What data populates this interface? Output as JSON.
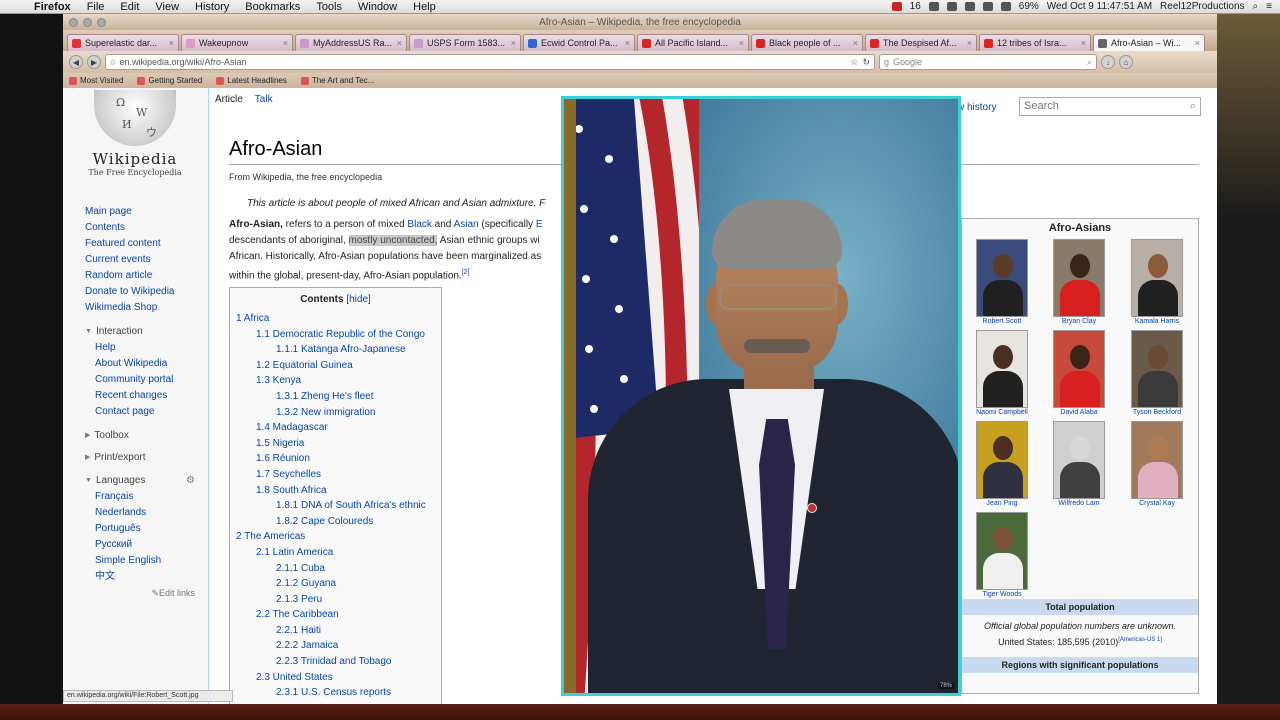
{
  "menubar": {
    "app": "Firefox",
    "items": [
      "File",
      "Edit",
      "View",
      "History",
      "Bookmarks",
      "Tools",
      "Window",
      "Help"
    ],
    "badge_count": "16",
    "battery": "69%",
    "clock": "Wed Oct 9  11:47:51 AM",
    "user": "Reel12Productions"
  },
  "window": {
    "title": "Afro-Asian – Wikipedia, the free encyclopedia"
  },
  "tabs": [
    {
      "label": "Superelastic dar...",
      "color": "#d33"
    },
    {
      "label": "Wakeupnow",
      "color": "#d9c"
    },
    {
      "label": "MyAddressUS Ra...",
      "color": "#c9c"
    },
    {
      "label": "USPS Form 1583...",
      "color": "#c9c"
    },
    {
      "label": "Ecwid Control Pa...",
      "color": "#36c"
    },
    {
      "label": "All Pacific Island...",
      "color": "#d22"
    },
    {
      "label": "Black people of ...",
      "color": "#d22"
    },
    {
      "label": "The Despised Af...",
      "color": "#d22"
    },
    {
      "label": "12 tribes of Isra...",
      "color": "#d22"
    },
    {
      "label": "Afro-Asian – Wi...",
      "color": "#666"
    }
  ],
  "navbar": {
    "url": "en.wikipedia.org/wiki/Afro-Asian",
    "search_placeholder": "Google"
  },
  "bookmarks": [
    "Most Visited",
    "Getting Started",
    "Latest Headlines",
    "The Art and Tec..."
  ],
  "wiki": {
    "logo_word": "Wikipedia",
    "logo_tag": "The Free Encyclopedia",
    "nav": [
      "Main page",
      "Contents",
      "Featured content",
      "Current events",
      "Random article",
      "Donate to Wikipedia",
      "Wikimedia Shop"
    ],
    "interaction_head": "Interaction",
    "interaction": [
      "Help",
      "About Wikipedia",
      "Community portal",
      "Recent changes",
      "Contact page"
    ],
    "toolbox": "Toolbox",
    "print": "Print/export",
    "languages_head": "Languages",
    "languages": [
      "Français",
      "Nederlands",
      "Português",
      "Русский",
      "Simple English",
      "中文"
    ],
    "edit_links": "Edit links",
    "tab_article": "Article",
    "tab_talk": "Talk",
    "view_history": "w history",
    "search_placeholder": "Search",
    "title": "Afro-Asian",
    "from": "From Wikipedia, the free encyclopedia",
    "hatnote": "This article is about people of mixed African and Asian admixture. F",
    "para": {
      "term": "Afro-Asian,",
      "t1": " refers to a person of mixed ",
      "black": "Black",
      "t2": " and ",
      "asian": "Asian",
      "t3": " (specifically ",
      "e": "E",
      "t4": "descendants of aboriginal, ",
      "hl": "mostly uncontacted,",
      "t5": " Asian ethnic groups wi",
      "t6": "African. Historically, Afro-Asian populations have been marginalized as",
      "t7": "within the global, present-day, Afro-Asian population.",
      "ref": "[2]"
    },
    "toc": {
      "title": "Contents",
      "hide": "[hide]",
      "rows": [
        {
          "lvl": 1,
          "t": "1 Africa"
        },
        {
          "lvl": 2,
          "t": "1.1 Democratic Republic of the Congo"
        },
        {
          "lvl": 3,
          "t": "1.1.1 Katanga Afro-Japanese"
        },
        {
          "lvl": 2,
          "t": "1.2 Equatorial Guinea"
        },
        {
          "lvl": 2,
          "t": "1.3 Kenya"
        },
        {
          "lvl": 3,
          "t": "1.3.1 Zheng He's fleet"
        },
        {
          "lvl": 3,
          "t": "1.3.2 New immigration"
        },
        {
          "lvl": 2,
          "t": "1.4 Madagascar"
        },
        {
          "lvl": 2,
          "t": "1.5 Nigeria"
        },
        {
          "lvl": 2,
          "t": "1.6 Réunion"
        },
        {
          "lvl": 2,
          "t": "1.7 Seychelles"
        },
        {
          "lvl": 2,
          "t": "1.8 South Africa"
        },
        {
          "lvl": 3,
          "t": "1.8.1 DNA of South Africa's ethnic"
        },
        {
          "lvl": 3,
          "t": "1.8.2 Cape Coloureds"
        },
        {
          "lvl": 1,
          "t": "2 The Americas"
        },
        {
          "lvl": 2,
          "t": "2.1 Latin America"
        },
        {
          "lvl": 3,
          "t": "2.1.1 Cuba"
        },
        {
          "lvl": 3,
          "t": "2.1.2 Guyana"
        },
        {
          "lvl": 3,
          "t": "2.1.3 Peru"
        },
        {
          "lvl": 2,
          "t": "2.2 The Caribbean"
        },
        {
          "lvl": 3,
          "t": "2.2.1 Haiti"
        },
        {
          "lvl": 3,
          "t": "2.2.2 Jamaica"
        },
        {
          "lvl": 3,
          "t": "2.2.3 Trinidad and Tobago"
        },
        {
          "lvl": 2,
          "t": "2.3 United States"
        },
        {
          "lvl": 3,
          "t": "2.3.1 U.S. Census reports"
        }
      ]
    },
    "infobox": {
      "title": "Afro-Asians",
      "people": [
        "Robert Scott",
        "Bryan Clay",
        "Kamala Harris",
        "Naomi Campbell",
        "David Alaba",
        "Tyson Beckford",
        "Jean Ping",
        "Wilfredo Lam",
        "Crystal Kay",
        "Tiger Woods"
      ],
      "total_population": "Total population",
      "official": "Official global population numbers are unknown.",
      "us": "United States: 185,595 (2010)",
      "us_ref": "[Americas-US 1]",
      "regions": "Regions with significant populations"
    }
  },
  "overlay": {
    "zoom": "78%"
  },
  "status_url": "en.wikipedia.org/wiki/File:Robert_Scott.jpg"
}
